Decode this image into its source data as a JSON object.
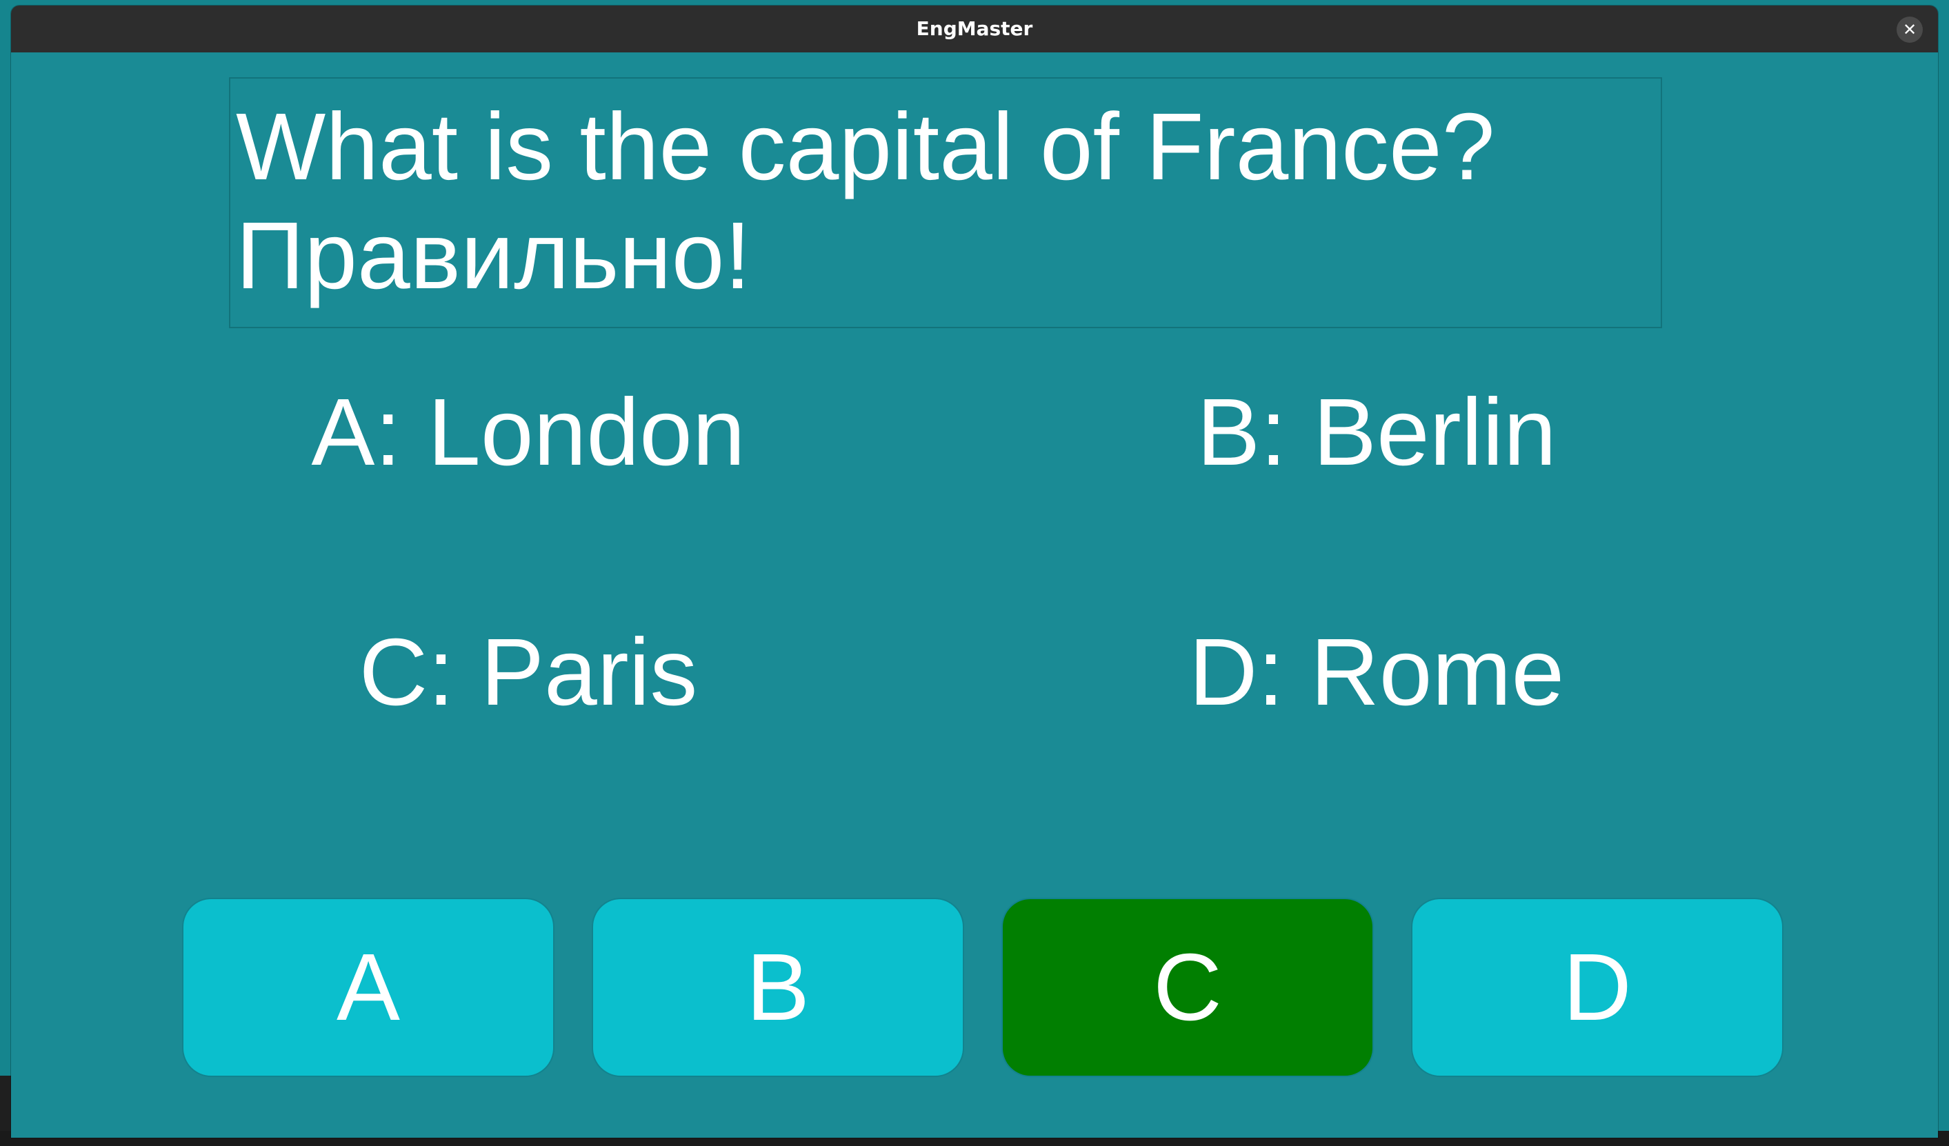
{
  "window": {
    "title": "EngMaster",
    "close_icon": "close-icon",
    "close_glyph": "✕"
  },
  "question": {
    "text": "What is the capital of France?",
    "feedback": "Правильно!"
  },
  "options": [
    {
      "label": "A: London"
    },
    {
      "label": "B: Berlin"
    },
    {
      "label": "C: Paris"
    },
    {
      "label": "D: Rome"
    }
  ],
  "buttons": [
    {
      "label": "A",
      "state": "default"
    },
    {
      "label": "B",
      "state": "default"
    },
    {
      "label": "C",
      "state": "correct"
    },
    {
      "label": "D",
      "state": "default"
    }
  ],
  "colors": {
    "background": "#1a8b95",
    "button": "#0bbfcd",
    "correct_button": "#017f01",
    "titlebar": "#2d2d2d",
    "text": "#ffffff"
  }
}
